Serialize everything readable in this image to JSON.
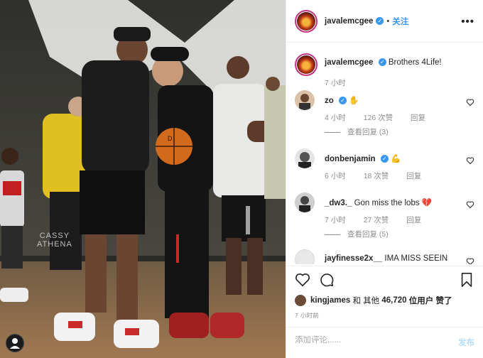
{
  "header": {
    "username": "javalemcgee",
    "dot": "•",
    "follow_label": "关注",
    "more_label": "•••"
  },
  "photo": {
    "watermark_line1": "CASSY",
    "watermark_line2": "ATHENA",
    "ball_text": "D"
  },
  "caption": {
    "username": "javalemcgee",
    "text": "Brothers 4Life!",
    "time": "7 小时"
  },
  "comments": [
    {
      "username": "zo",
      "text": "",
      "time": "4 小时",
      "likes": "126 次赞",
      "reply": "回复",
      "view_replies": "查看回复 (3)"
    },
    {
      "username": "donbenjamin",
      "text": "",
      "time": "6 小时",
      "likes": "18 次赞",
      "reply": "回复"
    },
    {
      "username": "_dw3._",
      "text": "Gon miss the lobs",
      "time": "7 小时",
      "likes": "27 次赞",
      "reply": "回复",
      "view_replies": "查看回复 (5)"
    },
    {
      "username": "jayfinesse2x__",
      "text": "IMA MISS SEEIN"
    }
  ],
  "likes": {
    "liker": "kingjames",
    "and_others": "和 其他",
    "count": "46,720",
    "suffix": "位用户 赞了"
  },
  "time_ago": "7 小时前",
  "add_comment": {
    "placeholder": "添加评论......",
    "post_label": "发布"
  },
  "icons": {
    "heart": "heart-icon",
    "comment": "comment-icon",
    "bookmark": "bookmark-icon",
    "verified": "verified-badge-icon",
    "more": "more-options-icon"
  },
  "colors": {
    "link": "#3897f0",
    "secondary": "#8e8e8e",
    "post_disabled": "#b2dffc"
  }
}
